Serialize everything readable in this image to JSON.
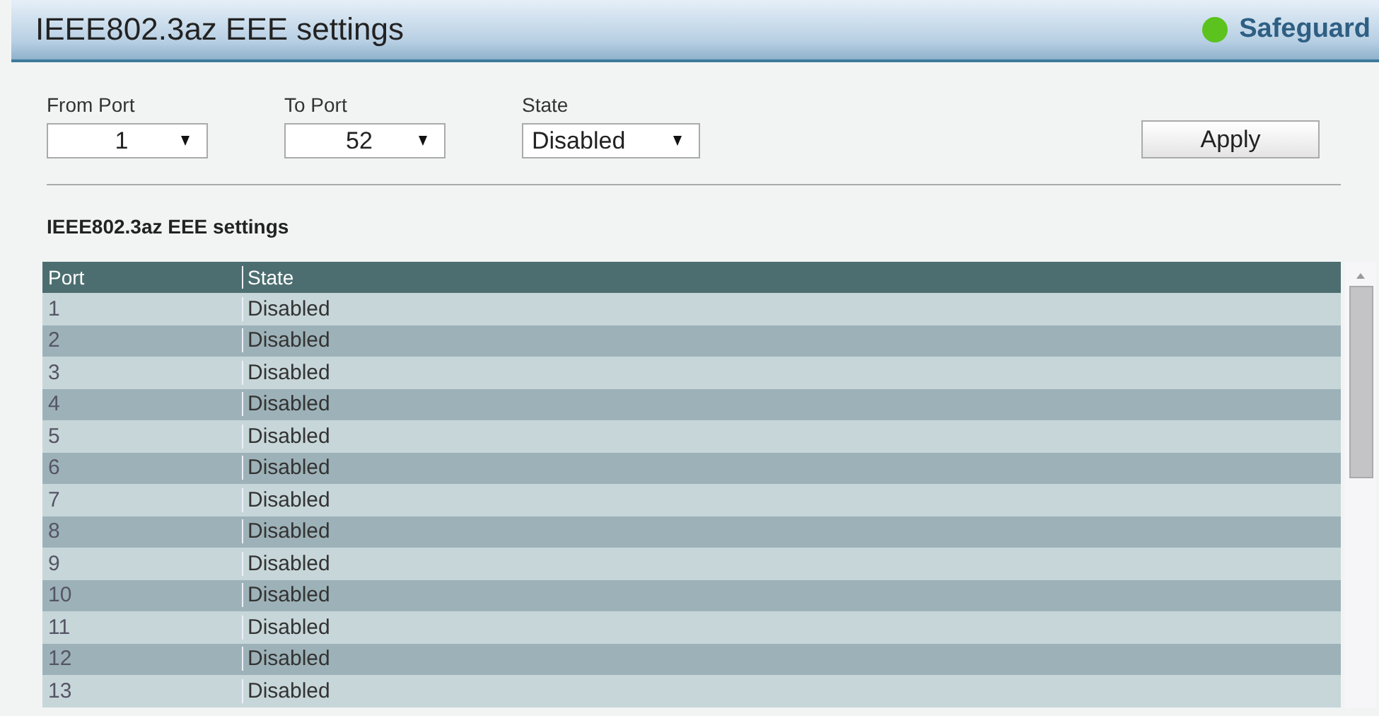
{
  "header": {
    "title": "IEEE802.3az EEE settings",
    "status": {
      "label": "Safeguard",
      "color": "#5cc21e"
    }
  },
  "form": {
    "fields": [
      {
        "label": "From Port",
        "value": "1",
        "kind": "select"
      },
      {
        "label": "To Port",
        "value": "52",
        "kind": "select"
      },
      {
        "label": "State",
        "value": "Disabled",
        "kind": "select"
      }
    ],
    "apply": "Apply"
  },
  "section_title": "IEEE802.3az EEE settings",
  "table": {
    "columns": [
      "Port",
      "State"
    ],
    "rows": [
      [
        "1",
        "Disabled"
      ],
      [
        "2",
        "Disabled"
      ],
      [
        "3",
        "Disabled"
      ],
      [
        "4",
        "Disabled"
      ],
      [
        "5",
        "Disabled"
      ],
      [
        "6",
        "Disabled"
      ],
      [
        "7",
        "Disabled"
      ],
      [
        "8",
        "Disabled"
      ],
      [
        "9",
        "Disabled"
      ],
      [
        "10",
        "Disabled"
      ],
      [
        "11",
        "Disabled"
      ],
      [
        "12",
        "Disabled"
      ],
      [
        "13",
        "Disabled"
      ]
    ]
  }
}
